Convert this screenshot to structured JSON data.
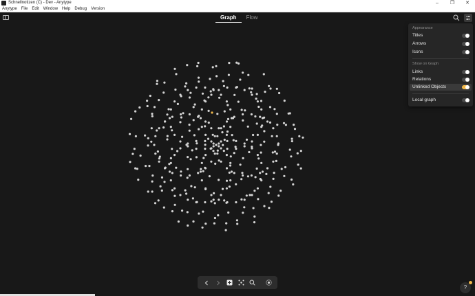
{
  "window": {
    "title": "Schnellnotizen (C) - Dev - Anytype",
    "controls": {
      "minimize": "–",
      "maximize": "❐",
      "close": "✕"
    }
  },
  "menubar": [
    "Anytype",
    "File",
    "Edit",
    "Window",
    "Help",
    "Debug",
    "Version"
  ],
  "header": {
    "tabs": [
      {
        "label": "Graph",
        "active": true
      },
      {
        "label": "Flow",
        "active": false
      }
    ],
    "icons": [
      "sidebar-toggle-icon",
      "search-icon",
      "settings-icon"
    ]
  },
  "settings": {
    "appearance_heading": "Appearance",
    "appearance": [
      {
        "label": "Titles",
        "on": false
      },
      {
        "label": "Arrows",
        "on": false
      },
      {
        "label": "Icons",
        "on": false
      }
    ],
    "show_heading": "Show on Graph",
    "show": [
      {
        "label": "Links",
        "on": false
      },
      {
        "label": "Relations",
        "on": false
      },
      {
        "label": "Unlinked Objects",
        "on": true
      }
    ],
    "local": [
      {
        "label": "Local graph",
        "on": false
      }
    ],
    "accent_color": "#f0b74a"
  },
  "bottom_nav": {
    "icons": [
      "arrow-left-icon",
      "arrow-right-icon",
      "plus-icon",
      "graph-icon",
      "search-icon",
      "record-icon"
    ]
  },
  "help": {
    "label": "?"
  },
  "graph": {
    "node_color": "#d4d4d4",
    "highlight_color": "#f0b74a"
  }
}
